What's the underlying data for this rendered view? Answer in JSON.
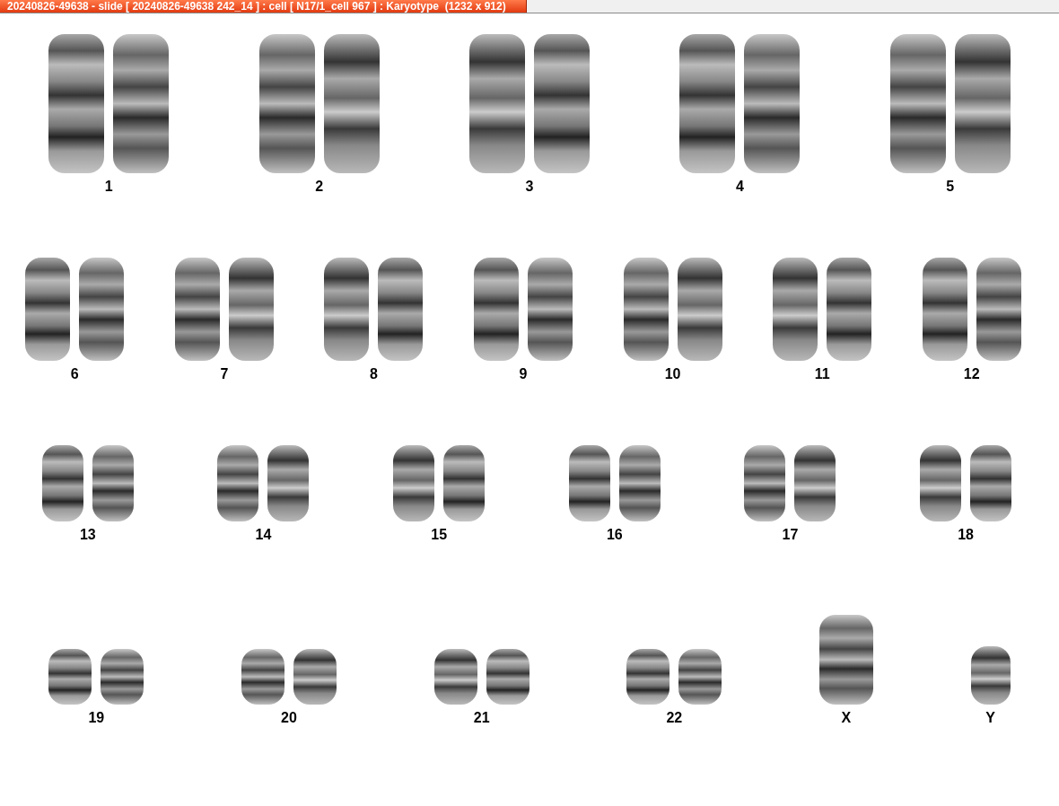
{
  "window": {
    "title": "20240826-49638 - slide [ 20240826-49638 242_14 ] : cell [ N17/1_cell 967 ] : Karyotype  (1232 x 912)"
  },
  "karyotype": {
    "rows": [
      {
        "chromosomes": [
          {
            "label": "1",
            "kind": "pair"
          },
          {
            "label": "2",
            "kind": "pair"
          },
          {
            "label": "3",
            "kind": "pair"
          },
          {
            "label": "4",
            "kind": "pair"
          },
          {
            "label": "5",
            "kind": "pair"
          }
        ]
      },
      {
        "chromosomes": [
          {
            "label": "6",
            "kind": "pair"
          },
          {
            "label": "7",
            "kind": "pair"
          },
          {
            "label": "8",
            "kind": "pair"
          },
          {
            "label": "9",
            "kind": "pair"
          },
          {
            "label": "10",
            "kind": "pair"
          },
          {
            "label": "11",
            "kind": "pair"
          },
          {
            "label": "12",
            "kind": "pair"
          }
        ]
      },
      {
        "chromosomes": [
          {
            "label": "13",
            "kind": "pair"
          },
          {
            "label": "14",
            "kind": "pair"
          },
          {
            "label": "15",
            "kind": "pair"
          },
          {
            "label": "16",
            "kind": "pair"
          },
          {
            "label": "17",
            "kind": "pair"
          },
          {
            "label": "18",
            "kind": "pair"
          }
        ]
      },
      {
        "chromosomes": [
          {
            "label": "19",
            "kind": "pair"
          },
          {
            "label": "20",
            "kind": "pair"
          },
          {
            "label": "21",
            "kind": "pair"
          },
          {
            "label": "22",
            "kind": "pair"
          },
          {
            "label": "X",
            "kind": "single"
          },
          {
            "label": "Y",
            "kind": "single"
          }
        ]
      }
    ]
  }
}
